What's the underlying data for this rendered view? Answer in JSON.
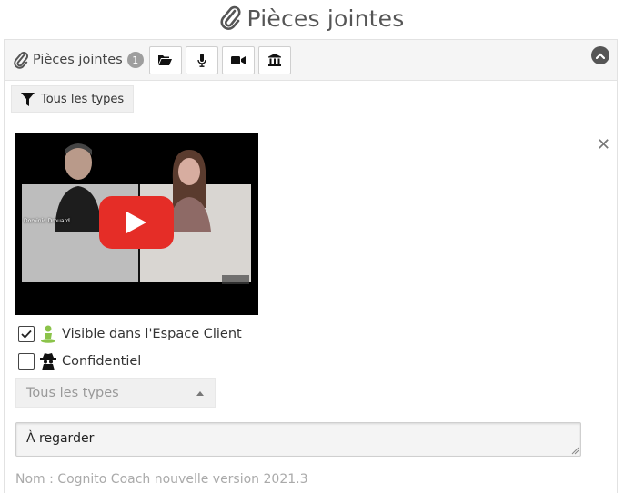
{
  "page": {
    "title": "Pièces jointes"
  },
  "panel": {
    "title": "Pièces jointes",
    "badge_count": "1",
    "toolbar": [
      {
        "icon": "folder-open-icon"
      },
      {
        "icon": "microphone-icon"
      },
      {
        "icon": "video-camera-icon"
      },
      {
        "icon": "bank-icon"
      }
    ],
    "collapse_icon": "chevron-up-icon"
  },
  "filter": {
    "label": "Tous les types",
    "icon": "filter-icon"
  },
  "attachment": {
    "video_overlay_caption": "Dominic Drouard",
    "visible_client": {
      "label": "Visible dans l'Espace Client",
      "checked": true,
      "icon": "client-person-icon"
    },
    "confidential": {
      "label": "Confidentiel",
      "checked": false,
      "icon": "spy-icon"
    },
    "type_select": {
      "value": "Tous les types"
    },
    "comment": {
      "value": "À regarder"
    },
    "name_line": "Nom : Cognito Coach nouvelle version 2021.3"
  },
  "colors": {
    "play_button": "#e52d27",
    "header_bg": "#f5f5f5",
    "client_icon_green": "#8bc34a"
  }
}
